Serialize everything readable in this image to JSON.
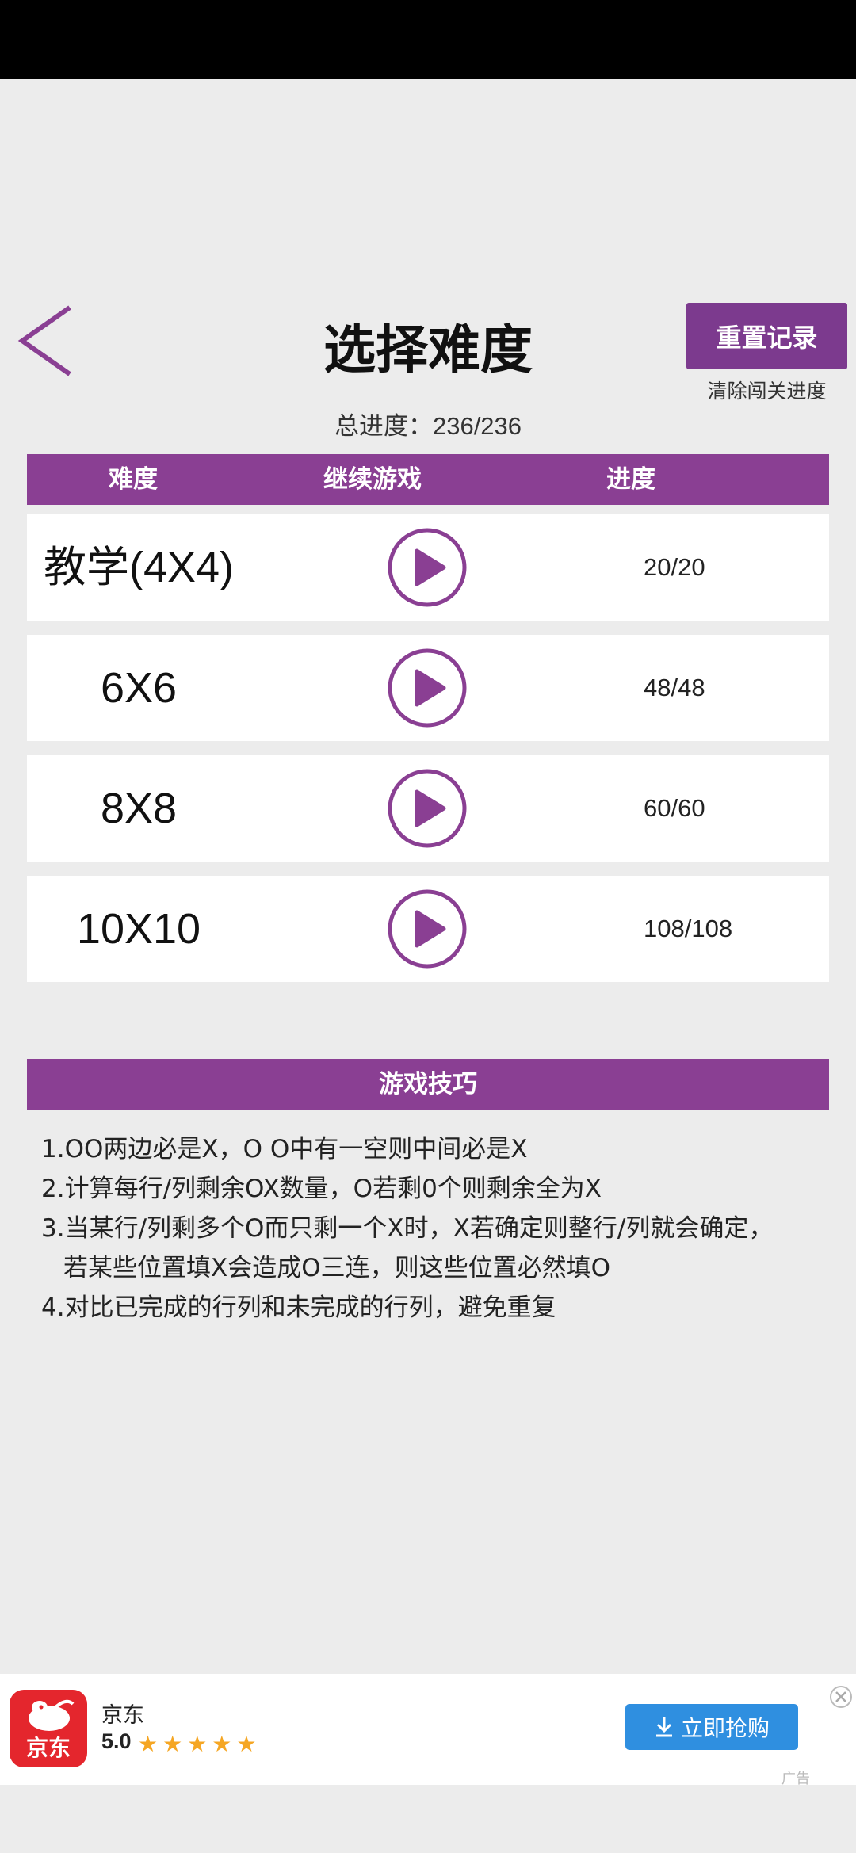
{
  "header": {
    "title": "选择难度",
    "reset_label": "重置记录",
    "reset_sub": "清除闯关进度",
    "total_prefix": "总进度：",
    "total_value": "236/236"
  },
  "table": {
    "columns": [
      "难度",
      "继续游戏",
      "进度"
    ],
    "rows": [
      {
        "name": "教学(4X4)",
        "progress": "20/20"
      },
      {
        "name": "6X6",
        "progress": "48/48"
      },
      {
        "name": "8X8",
        "progress": "60/60"
      },
      {
        "name": "10X10",
        "progress": "108/108"
      }
    ]
  },
  "tips": {
    "title": "游戏技巧",
    "lines": [
      "1.OO两边必是X，O O中有一空则中间必是X",
      "2.计算每行/列剩余OX数量，O若剩0个则剩余全为X",
      "3.当某行/列剩多个O而只剩一个X时，X若确定则整行/列就会确定，",
      "若某些位置填X会造成O三连，则这些位置必然填O",
      "4.对比已完成的行列和未完成的行列，避免重复"
    ]
  },
  "ad": {
    "logo_text": "京东",
    "name": "京东",
    "rating": "5.0",
    "stars": "★★★★★",
    "cta": "立即抢购",
    "tag": "广告"
  },
  "colors": {
    "accent": "#8a3f93",
    "button": "#7c3a8e",
    "cta": "#2f8fe0"
  }
}
